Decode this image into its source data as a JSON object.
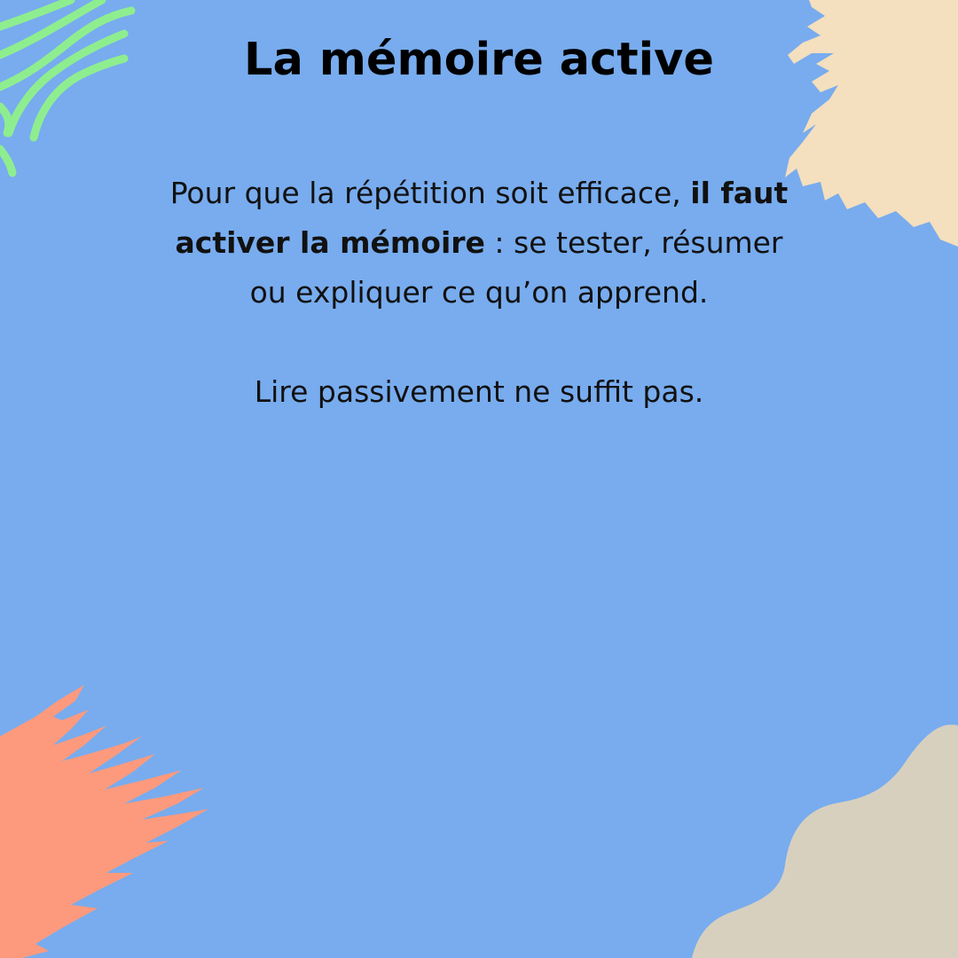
{
  "colors": {
    "background": "#78acee",
    "green_lines": "#8eee8f",
    "cream_splash": "#f4dfbe",
    "salmon_splash": "#fd9a7d",
    "beige_blob": "#d8d0bf",
    "text": "#000000"
  },
  "title": "La mémoire active",
  "paragraph": {
    "part1": "Pour que la répétition soit efficace, ",
    "bold": "il faut activer la mémoire",
    "part2": " : se tester, résumer ou expliquer ce qu’on apprend."
  },
  "closing": "Lire passivement ne suffit pas."
}
